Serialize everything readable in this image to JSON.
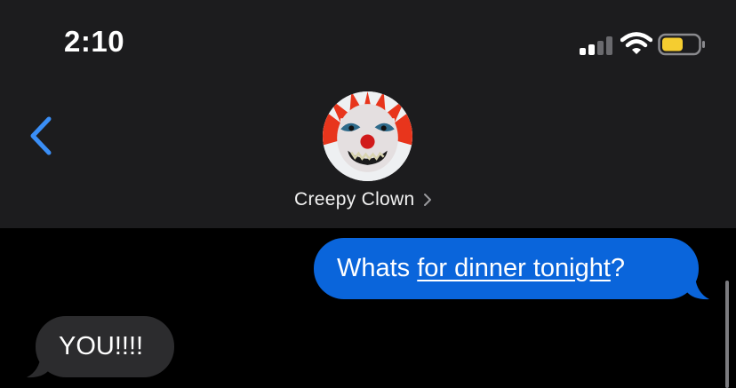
{
  "status_bar": {
    "time": "2:10"
  },
  "contact": {
    "name": "Creepy Clown"
  },
  "messages": [
    {
      "direction": "outgoing",
      "text_before": "Whats ",
      "link_text": "for dinner tonight",
      "text_after": "?"
    },
    {
      "direction": "incoming",
      "text": "YOU!!!!"
    }
  ],
  "colors": {
    "outgoing_bubble": "#0a65db",
    "incoming_bubble": "#2c2c2e",
    "header_bg": "#1c1c1e",
    "accent": "#3a8ef6",
    "battery_fill": "#f5cd30"
  },
  "icons": [
    "back-chevron-icon",
    "cellular-signal-icon",
    "wifi-icon",
    "battery-icon",
    "disclosure-chevron-icon"
  ]
}
